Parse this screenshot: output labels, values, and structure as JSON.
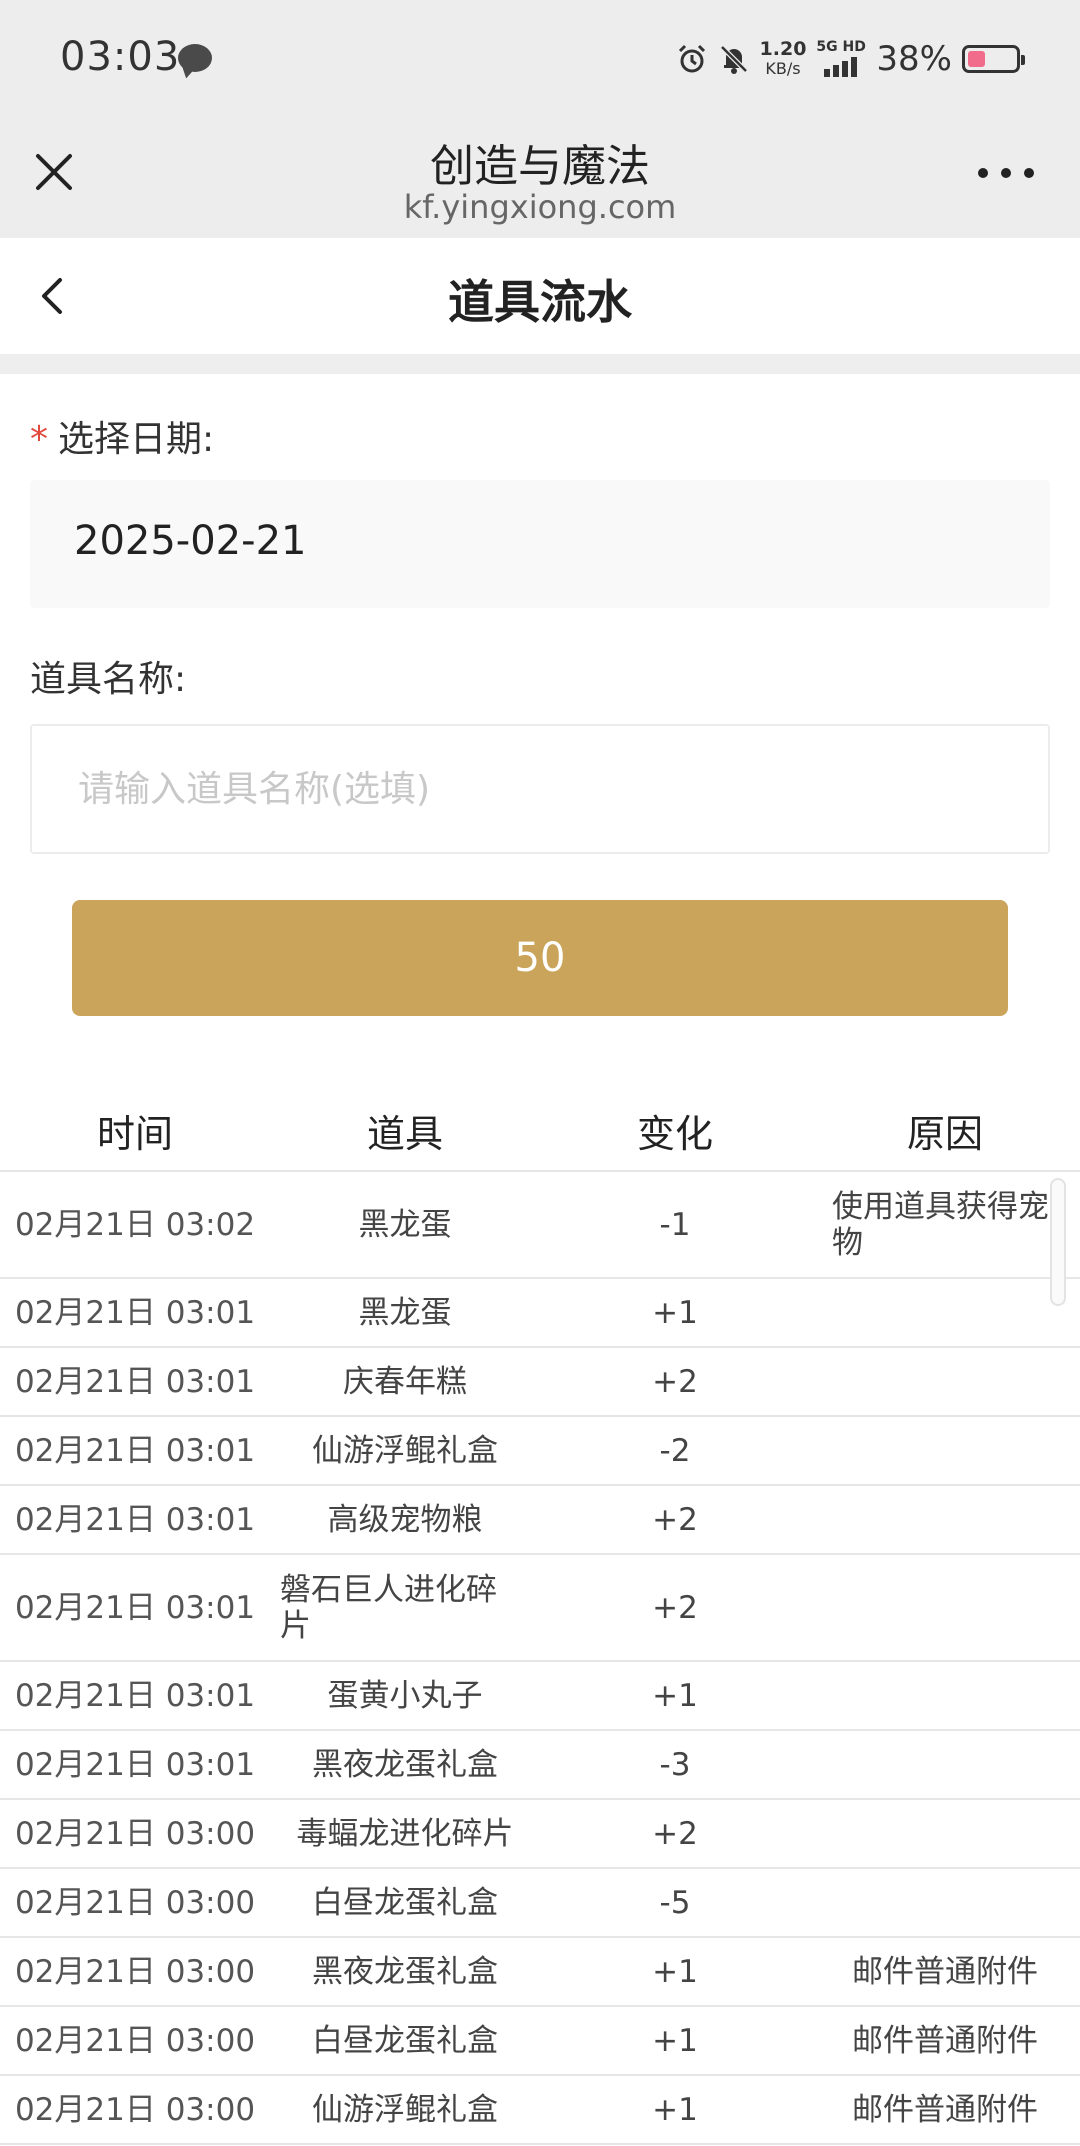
{
  "status_bar": {
    "time": "03:03",
    "speed_value": "1.20",
    "speed_unit": "KB/s",
    "network_label": "5G HD",
    "battery_percent": "38%",
    "battery_level": 0.38
  },
  "browser": {
    "title": "创造与魔法",
    "url": "kf.yingxiong.com"
  },
  "page": {
    "title": "道具流水"
  },
  "form": {
    "date_required_mark": "*",
    "date_label": "选择日期:",
    "date_value": "2025-02-21",
    "item_label": "道具名称:",
    "item_placeholder": "请输入道具名称(选填)",
    "submit_label": "50"
  },
  "table": {
    "headers": [
      "时间",
      "道具",
      "变化",
      "原因"
    ],
    "rows": [
      {
        "time": "02月21日 03:02",
        "item": "黑龙蛋",
        "change": "-1",
        "reason": "使用道具获得宠物"
      },
      {
        "time": "02月21日 03:01",
        "item": "黑龙蛋",
        "change": "+1",
        "reason": ""
      },
      {
        "time": "02月21日 03:01",
        "item": "庆春年糕",
        "change": "+2",
        "reason": ""
      },
      {
        "time": "02月21日 03:01",
        "item": "仙游浮鲲礼盒",
        "change": "-2",
        "reason": ""
      },
      {
        "time": "02月21日 03:01",
        "item": "高级宠物粮",
        "change": "+2",
        "reason": ""
      },
      {
        "time": "02月21日 03:01",
        "item": "磐石巨人进化碎片",
        "change": "+2",
        "reason": ""
      },
      {
        "time": "02月21日 03:01",
        "item": "蛋黄小丸子",
        "change": "+1",
        "reason": ""
      },
      {
        "time": "02月21日 03:01",
        "item": "黑夜龙蛋礼盒",
        "change": "-3",
        "reason": ""
      },
      {
        "time": "02月21日 03:00",
        "item": "毒蝠龙进化碎片",
        "change": "+2",
        "reason": ""
      },
      {
        "time": "02月21日 03:00",
        "item": "白昼龙蛋礼盒",
        "change": "-5",
        "reason": ""
      },
      {
        "time": "02月21日 03:00",
        "item": "黑夜龙蛋礼盒",
        "change": "+1",
        "reason": "邮件普通附件"
      },
      {
        "time": "02月21日 03:00",
        "item": "白昼龙蛋礼盒",
        "change": "+1",
        "reason": "邮件普通附件"
      },
      {
        "time": "02月21日 03:00",
        "item": "仙游浮鲲礼盒",
        "change": "+1",
        "reason": "邮件普通附件"
      }
    ]
  }
}
